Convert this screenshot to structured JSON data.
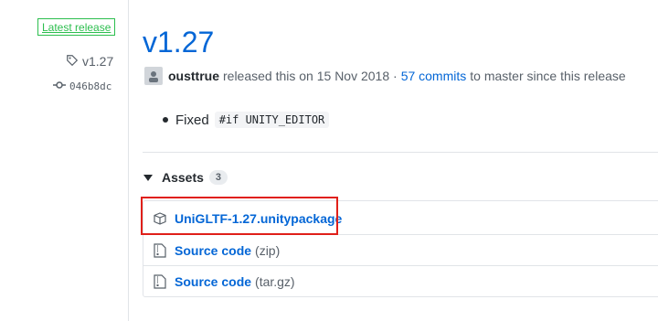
{
  "sidebar": {
    "latest_release": "Latest release",
    "tag": "v1.27",
    "commit": "046b8dc"
  },
  "release": {
    "title": "v1.27",
    "author": "ousttrue",
    "released_text": "released this on 15 Nov 2018 ·",
    "commits_link": "57 commits",
    "since_text": "to master since this release",
    "notes_prefix": "Fixed",
    "notes_code": "#if UNITY_EDITOR"
  },
  "assets": {
    "label": "Assets",
    "count": "3",
    "items": [
      {
        "name": "UniGLTF-1.27.unitypackage",
        "ext": "",
        "icon": "package-icon"
      },
      {
        "name": "Source code",
        "ext": "(zip)",
        "icon": "file-zip-icon"
      },
      {
        "name": "Source code",
        "ext": "(tar.gz)",
        "icon": "file-zip-icon"
      }
    ]
  },
  "colors": {
    "link": "#0366d6",
    "badge_green": "#2cbe4e",
    "highlight_red": "#e0201a"
  }
}
